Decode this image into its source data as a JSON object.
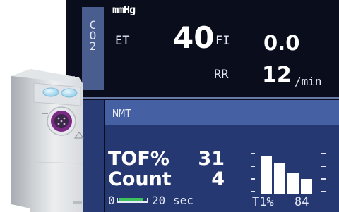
{
  "co2": {
    "side_label": [
      "C",
      "O",
      "2"
    ],
    "unit": "mmHg",
    "et_label": "ET",
    "et_value": "40",
    "fi_label": "FI",
    "fi_value": "0.0",
    "rr_label": "RR",
    "rr_value": "12",
    "rr_unit": "/min"
  },
  "nmt": {
    "title": "NMT",
    "tof_label": "TOF%",
    "tof_value": "31",
    "count_label": "Count",
    "count_value": "4",
    "timer_start": "0",
    "timer_end": "20",
    "timer_unit": "sec",
    "timer_progress": 0.8,
    "t1_label": "T1%",
    "t1_value": "84",
    "histogram_levels": [
      1.0,
      0.8,
      0.55,
      0.4
    ]
  },
  "colors": {
    "screen_bg": "#0a0e1c",
    "panel_bg": "#253872",
    "header_bg": "#4560a3",
    "accent_green": "#3ec25c",
    "connector_ring": "#7b2a86",
    "button_blue": "#9fd6ee"
  },
  "icons": {
    "connector": "circular-pin-connector-icon",
    "button": "pill-button-icon"
  }
}
